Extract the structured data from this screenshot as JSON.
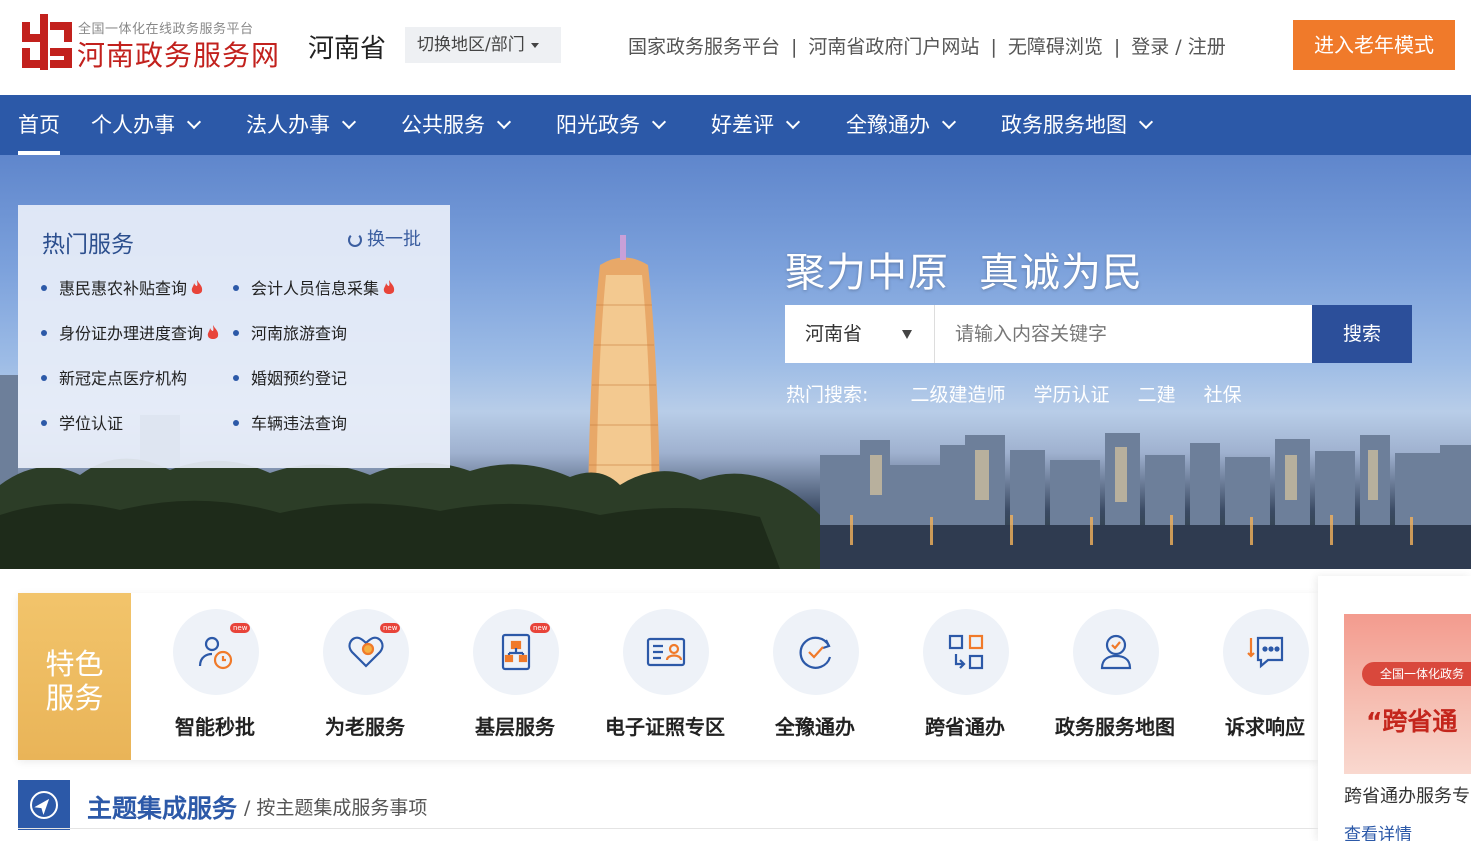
{
  "header": {
    "logo_subtitle": "全国一体化在线政务服务平台",
    "logo_title": "河南政务服务网",
    "province": "河南省",
    "switch_label": "切换地区/部门",
    "links": [
      "国家政务服务平台",
      "河南省政府门户网站",
      "无障碍浏览"
    ],
    "login": "登录",
    "register": "注册",
    "login_sep": "/",
    "elder_mode": "进入老年模式",
    "brand_color": "#c2211d",
    "elder_color": "#f07a2a"
  },
  "nav": {
    "items": [
      {
        "label": "首页",
        "active": true
      },
      {
        "label": "个人办事"
      },
      {
        "label": "法人办事"
      },
      {
        "label": "公共服务"
      },
      {
        "label": "阳光政务"
      },
      {
        "label": "好差评"
      },
      {
        "label": "全豫通办"
      },
      {
        "label": "政务服务地图"
      }
    ],
    "color": "#2c59a8"
  },
  "hot_services": {
    "title": "热门服务",
    "refresh": "换一批",
    "items": [
      {
        "label": "惠民惠农补贴查询",
        "hot": true
      },
      {
        "label": "会计人员信息采集",
        "hot": true
      },
      {
        "label": "身份证办理进度查询",
        "hot": true
      },
      {
        "label": "河南旅游查询"
      },
      {
        "label": "新冠定点医疗机构"
      },
      {
        "label": "婚姻预约登记"
      },
      {
        "label": "学位认证"
      },
      {
        "label": "车辆违法查询"
      }
    ]
  },
  "banner": {
    "slogan_a": "聚力中原",
    "slogan_b": "真诚为民",
    "search": {
      "region": "河南省",
      "placeholder": "请输入内容关键字",
      "button": "搜索"
    },
    "hot_search_label": "热门搜索:",
    "hot_keywords": [
      "二级建造师",
      "学历认证",
      "二建",
      "社保"
    ]
  },
  "features": {
    "label_line1": "特色",
    "label_line2": "服务",
    "new_badge": "new",
    "items": [
      {
        "label": "智能秒批",
        "icon": "approval-clock-icon",
        "new": true
      },
      {
        "label": "为老服务",
        "icon": "heart-elder-icon",
        "new": true
      },
      {
        "label": "基层服务",
        "icon": "org-chart-icon",
        "new": true
      },
      {
        "label": "电子证照专区",
        "icon": "id-card-icon"
      },
      {
        "label": "全豫通办",
        "icon": "circular-check-icon"
      },
      {
        "label": "跨省通办",
        "icon": "transfer-arrows-icon"
      },
      {
        "label": "政务服务地图",
        "icon": "location-person-icon"
      },
      {
        "label": "诉求响应",
        "icon": "chat-bubble-icon"
      }
    ],
    "icon_color": "#2c59a8",
    "label_bg": "#eeb85f"
  },
  "side_card": {
    "pill_text": "全国一体化政务",
    "big_text": "“跨省通",
    "title": "跨省通办服务专",
    "link": "查看详情"
  },
  "theme": {
    "title": "主题集成服务",
    "separator": "/",
    "subtitle": "按主题集成服务事项"
  }
}
